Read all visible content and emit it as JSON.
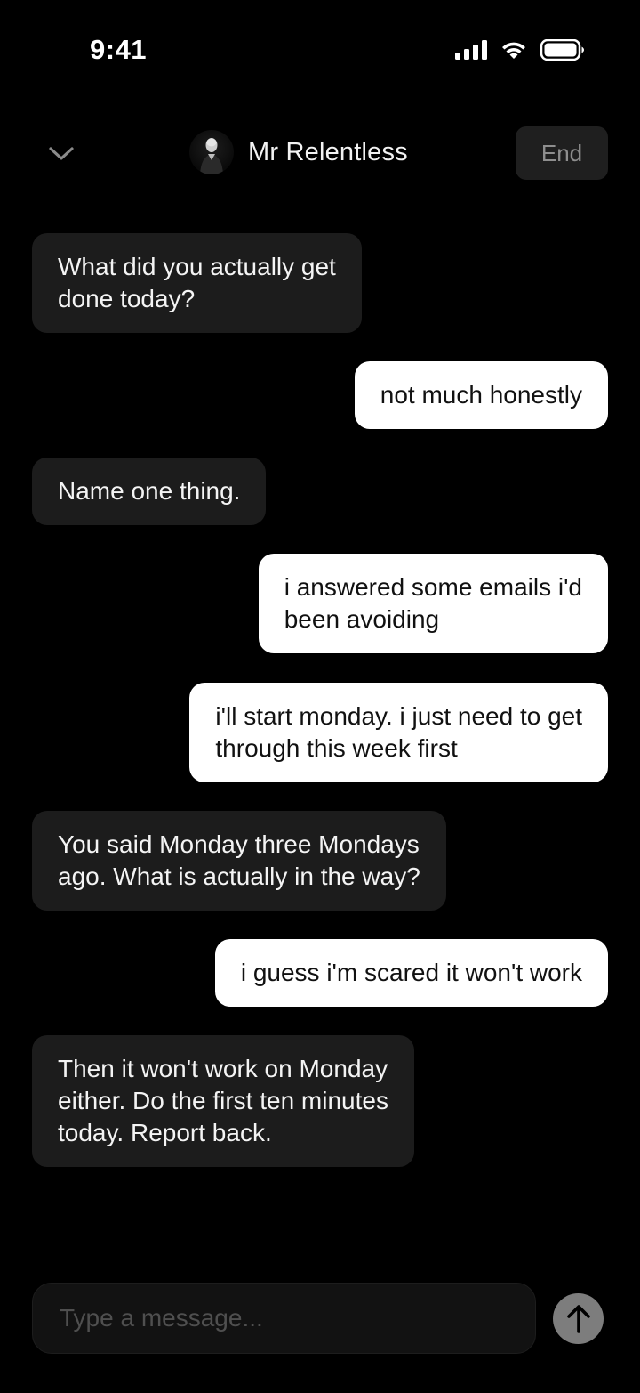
{
  "status_bar": {
    "time": "9:41",
    "icons": [
      "cellular-signal-icon",
      "wifi-icon",
      "battery-icon"
    ]
  },
  "header": {
    "collapse_icon": "chevron-down-icon",
    "contact_name": "Mr Relentless",
    "end_label": "End"
  },
  "messages": [
    {
      "direction": "incoming",
      "lines": [
        "What did you actually get",
        "done today?"
      ]
    },
    {
      "direction": "outgoing",
      "lines": [
        "not much honestly"
      ]
    },
    {
      "direction": "incoming",
      "lines": [
        "Name one thing."
      ]
    },
    {
      "direction": "outgoing",
      "lines": [
        "i answered some emails i'd",
        "been avoiding"
      ]
    },
    {
      "direction": "outgoing",
      "lines": [
        "i'll start monday. i just need to get",
        "through this week first"
      ]
    },
    {
      "direction": "incoming",
      "lines": [
        "You said Monday three Mondays",
        "ago. What is actually in the way?"
      ]
    },
    {
      "direction": "outgoing",
      "lines": [
        "i guess i'm scared it won't work"
      ]
    },
    {
      "direction": "incoming",
      "lines": [
        "Then it won't work on Monday",
        "either. Do the first ten minutes",
        "today. Report back."
      ]
    }
  ],
  "composer": {
    "placeholder": "Type a message...",
    "value": "",
    "send_icon": "arrow-up-icon"
  },
  "colors": {
    "background": "#000000",
    "incoming_bubble": "#1c1c1c",
    "outgoing_bubble": "#ffffff",
    "end_button": "#1f1f1f",
    "send_button": "#7d7d7d"
  }
}
